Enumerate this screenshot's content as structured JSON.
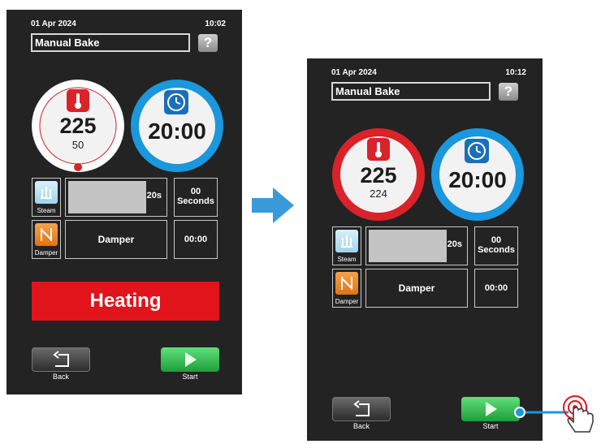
{
  "screen_before": {
    "date": "01 Apr 2024",
    "time": "10:02",
    "title": "Manual Bake",
    "help_label": "?",
    "temperature": {
      "set": "225",
      "current": "50"
    },
    "timer": "20:00",
    "steam": {
      "label": "Steam",
      "bar_text": "20s",
      "value_line1": "00",
      "value_line2": "Seconds"
    },
    "damper": {
      "label": "Damper",
      "cell_text": "Damper",
      "value": "00:00"
    },
    "status": "Heating",
    "back_label": "Back",
    "start_label": "Start"
  },
  "screen_after": {
    "date": "01 Apr 2024",
    "time": "10:12",
    "title": "Manual Bake",
    "help_label": "?",
    "temperature": {
      "set": "225",
      "current": "224"
    },
    "timer": "20:00",
    "steam": {
      "label": "Steam",
      "bar_text": "20s",
      "value_line1": "00",
      "value_line2": "Seconds"
    },
    "damper": {
      "label": "Damper",
      "cell_text": "Damper",
      "value": "00:00"
    },
    "back_label": "Back",
    "start_label": "Start"
  },
  "colors": {
    "accent_blue": "#1a97dd",
    "heating_red": "#e1141b",
    "start_green": "#2eb84a",
    "transition_arrow": "#3a9ad9"
  },
  "icons": [
    "thermometer-icon",
    "clock-icon",
    "steam-icon",
    "damper-icon",
    "back-arrow-icon",
    "play-icon",
    "help-icon",
    "touch-hand-icon",
    "transition-arrow-icon"
  ]
}
